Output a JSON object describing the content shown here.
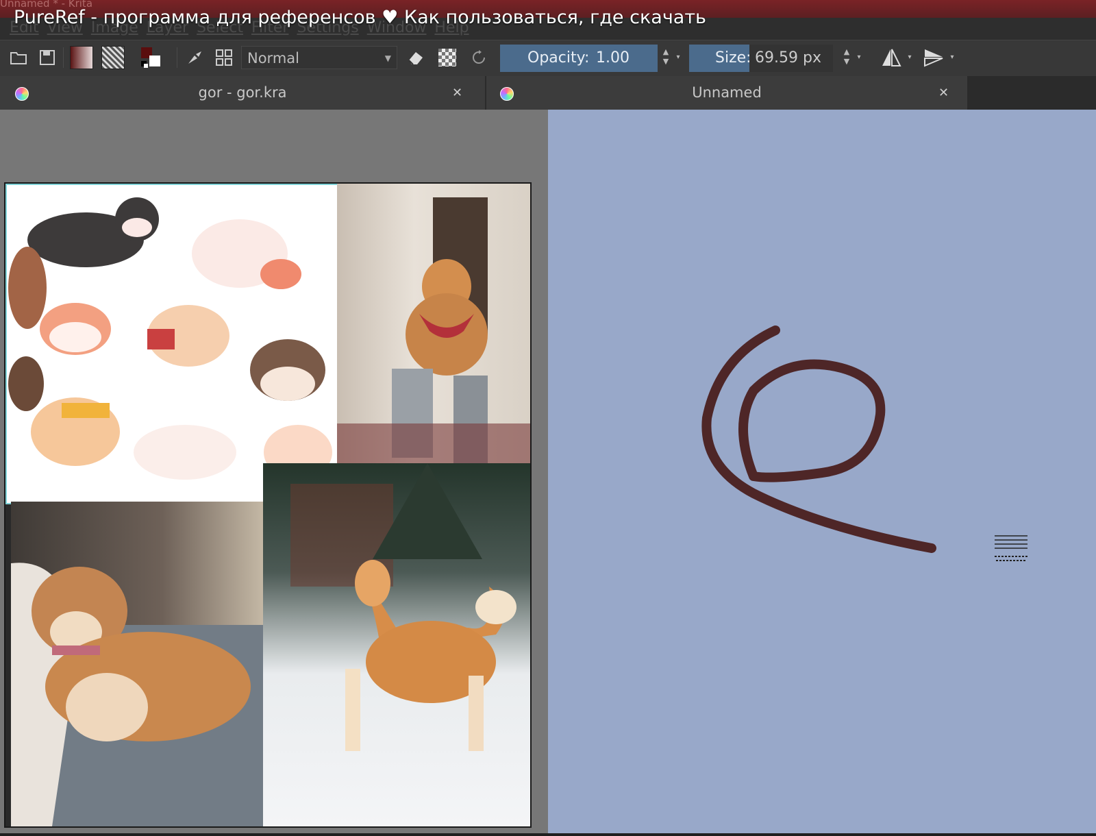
{
  "window": {
    "title": "Unnamed * - Krita"
  },
  "video_title": "PureRef - программа для референсов ♥ Как пользоваться, где скачать",
  "menu": [
    "Edit",
    "View",
    "Image",
    "Layer",
    "Select",
    "Filter",
    "Settings",
    "Window",
    "Help"
  ],
  "toolbar": {
    "blend_mode": "Normal",
    "opacity_label": "Opacity:",
    "opacity_value": "1.00",
    "size_label": "Size:",
    "size_value": "69.59 px",
    "icons": [
      "open-file-icon",
      "save-icon",
      "gradient-icon",
      "pattern-icon",
      "fg-bg-colors-icon",
      "brush-preset-icon",
      "grid-icon",
      "eraser-icon",
      "alpha-lock-icon",
      "reload-icon",
      "mirror-horizontal-icon",
      "mirror-vertical-icon"
    ]
  },
  "tabs": [
    {
      "label": "gor - gor.kra",
      "close": "✕"
    },
    {
      "label": "Unnamed",
      "close": "✕"
    }
  ],
  "colors": {
    "title_bar": "#7a2326",
    "right_canvas": "#98a8c9",
    "stroke": "#4a1f1f",
    "slider_accent": "#4b6b8c"
  }
}
